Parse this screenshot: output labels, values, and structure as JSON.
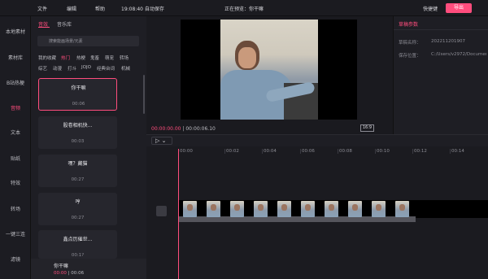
{
  "menu": {
    "file": "文件",
    "edit": "编辑",
    "help": "帮助",
    "autosave": "19:08:40 自动保存"
  },
  "header": {
    "title": "正在预览：你干嘛",
    "shortcut": "快捷键",
    "export": "导出"
  },
  "left_nav": [
    {
      "label": "本地素材",
      "active": false
    },
    {
      "label": "素材库",
      "active": false
    },
    {
      "label": "B站热梗",
      "active": false
    },
    {
      "label": "音频",
      "active": true
    },
    {
      "label": "文本",
      "active": false
    },
    {
      "label": "贴纸",
      "active": false
    },
    {
      "label": "特效",
      "active": false
    },
    {
      "label": "转场",
      "active": false
    },
    {
      "label": "一键三连",
      "active": false
    },
    {
      "label": "滤镜",
      "active": false
    }
  ],
  "library": {
    "tabs": [
      {
        "label": "音效",
        "active": true
      },
      {
        "label": "音乐库",
        "active": false
      }
    ],
    "search_placeholder": "搜索能画场景/元素",
    "categories_row1": [
      {
        "label": "我的收藏",
        "active": false
      },
      {
        "label": "热门",
        "active": true
      },
      {
        "label": "热梗",
        "active": false
      },
      {
        "label": "鬼畜",
        "active": false
      },
      {
        "label": "萌宠",
        "active": false
      },
      {
        "label": "转场",
        "active": false
      }
    ],
    "categories_row2": [
      {
        "label": "综艺",
        "active": false
      },
      {
        "label": "动漫",
        "active": false
      },
      {
        "label": "打斗",
        "active": false
      },
      {
        "label": "JOJO",
        "active": false
      },
      {
        "label": "经典台词",
        "active": false
      },
      {
        "label": "机械",
        "active": false
      }
    ],
    "cards": [
      {
        "name": "你干嘛",
        "duration": "00:06",
        "selected": true
      },
      {
        "name": "股卷相机快...",
        "duration": "00:03",
        "selected": false
      },
      {
        "name": "嘿？藏猫",
        "duration": "00:27",
        "selected": false
      },
      {
        "name": "哼",
        "duration": "00:27",
        "selected": false
      },
      {
        "name": "鑫点历催世...",
        "duration": "00:1?",
        "selected": false
      }
    ],
    "player": {
      "name": "你干嘛",
      "current": "00:00",
      "sep": " | ",
      "total": "00:06"
    }
  },
  "preview": {
    "current": "00:00:00.00",
    "sep": " | ",
    "total": "00:00:06.10",
    "ratio": "16:9"
  },
  "props": {
    "title": "草稿参数",
    "rows": [
      {
        "label": "草稿名称：",
        "value": "202211201907"
      },
      {
        "label": "保存位置：",
        "value": "C:/Users/v2972/Documents"
      }
    ]
  },
  "timeline": {
    "tool": "▷ ⌄",
    "ticks": [
      "00:00",
      "00:02",
      "00:04",
      "00:06",
      "00:08",
      "00:10",
      "00:12",
      "00:14"
    ]
  },
  "colors": {
    "accent": "#ff4d7d",
    "bg": "#16161a",
    "panel": "#1e1e24"
  }
}
